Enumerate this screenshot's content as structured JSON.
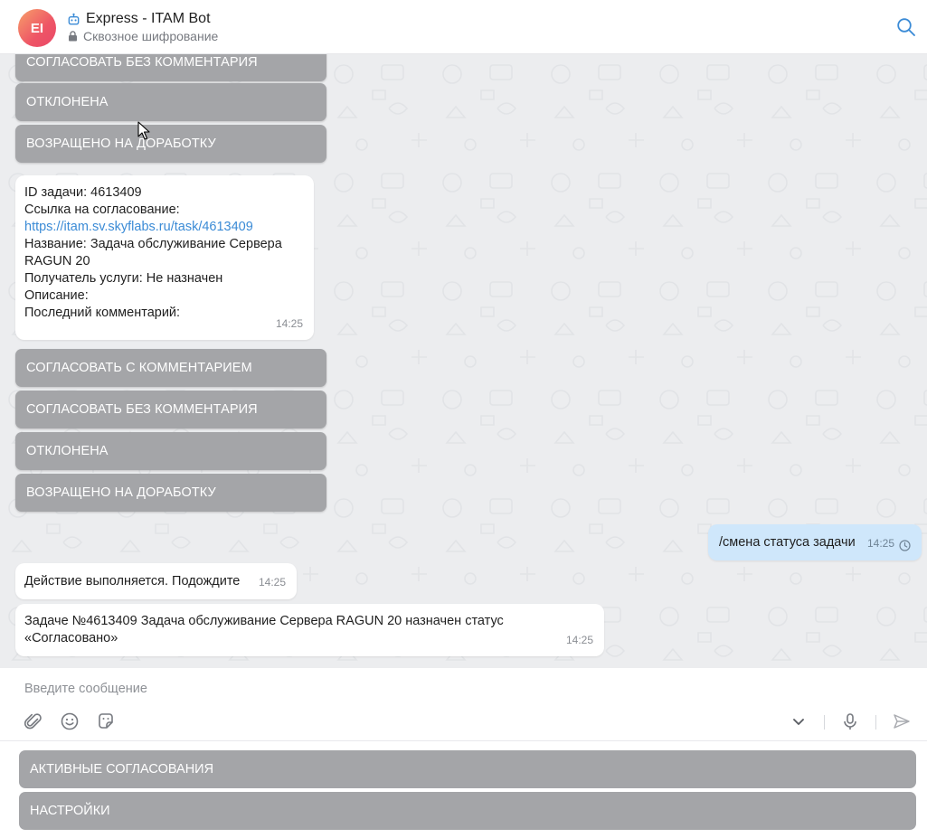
{
  "header": {
    "avatar_initials": "EI",
    "title": "Express - ITAM Bot",
    "subtitle": "Сквозное шифрование",
    "icons": [
      "bot-icon",
      "lock-icon",
      "search-icon"
    ]
  },
  "messages": {
    "top_keyboard": [
      "СОГЛАСОВАТЬ БЕЗ КОММЕНТАРИЯ",
      "ОТКЛОНЕНА",
      "ВОЗРАЩЕНО НА ДОРАБОТКУ"
    ],
    "task_info": {
      "line1": "ID задачи: 4613409",
      "line2": "Ссылка на согласование:",
      "link": "https://itam.sv.skyflabs.ru/task/4613409",
      "line3": "Название: Задача обслуживание Сервера",
      "line4": "RAGUN 20",
      "line5": "Получатель услуги: Не назначен",
      "line6": "Описание:",
      "line7": "Последний комментарий:",
      "time": "14:25"
    },
    "keyboard": [
      "СОГЛАСОВАТЬ С КОММЕНТАРИЕМ",
      "СОГЛАСОВАТЬ БЕЗ КОММЕНТАРИЯ",
      "ОТКЛОНЕНА",
      "ВОЗРАЩЕНО НА ДОРАБОТКУ"
    ],
    "outgoing": {
      "text": "/смена статуса задачи",
      "time": "14:25",
      "status_icon": "clock-icon"
    },
    "action": {
      "text": "Действие выполняется. Подождите",
      "time": "14:25"
    },
    "status": {
      "line1": "Задаче №4613409 Задача обслуживание Сервера RAGUN 20 назначен статус",
      "line2": "«Согласовано»",
      "time": "14:25"
    }
  },
  "composer": {
    "placeholder": "Введите сообщение",
    "icons": [
      "attach-icon",
      "emoji-icon",
      "sticker-icon",
      "chevron-down-icon",
      "microphone-icon",
      "send-icon"
    ]
  },
  "bottom_keyboard": [
    "АКТИВНЫЕ СОГЛАСОВАНИЯ",
    "НАСТРОЙКИ"
  ],
  "colors": {
    "keyboard_button": "#a4a5a8",
    "outgoing_bubble": "#cfe7fb",
    "link": "#3b8bd6",
    "chat_background": "#ecedef",
    "accent": "#3b8bd6"
  }
}
